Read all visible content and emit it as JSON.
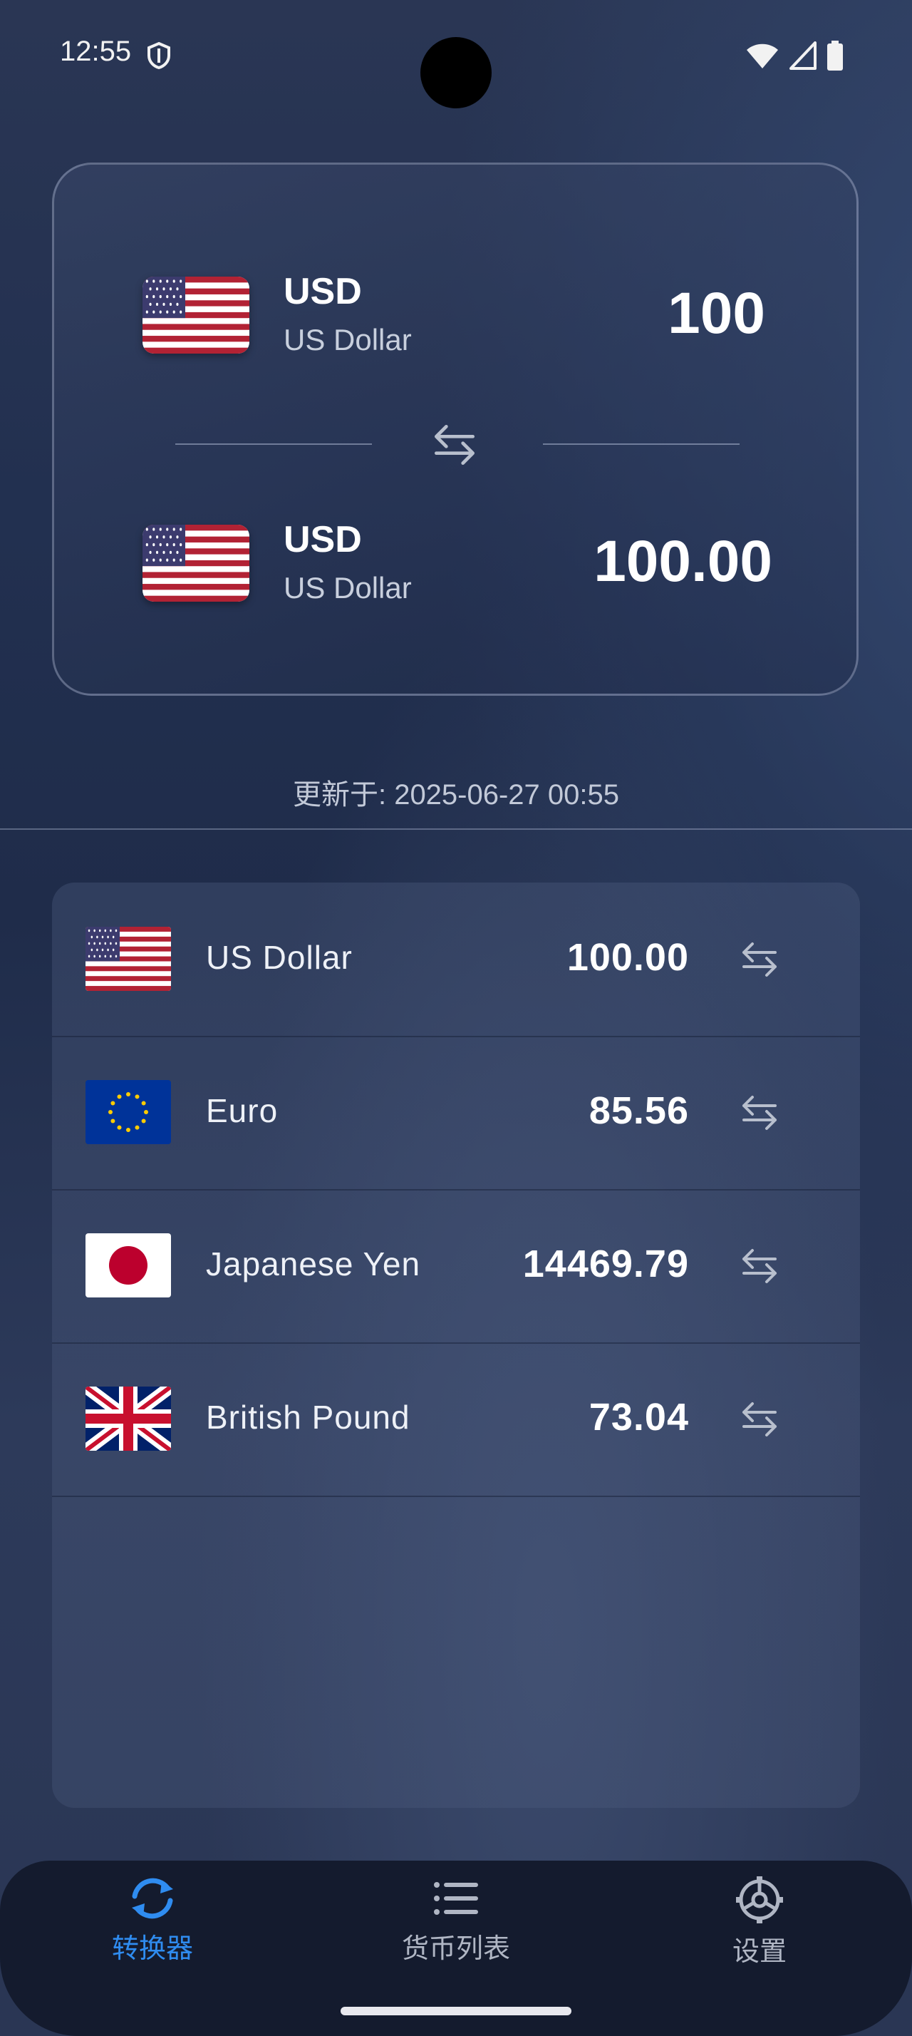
{
  "status_bar": {
    "time": "12:55"
  },
  "converter": {
    "from": {
      "code": "USD",
      "name": "US Dollar",
      "amount": "100",
      "flag": "us-flag"
    },
    "to": {
      "code": "USD",
      "name": "US Dollar",
      "amount": "100.00",
      "flag": "us-flag"
    },
    "swap_icon": "swap-horizontal-icon"
  },
  "updated_text": "更新于: 2025-06-27 00:55",
  "rates": [
    {
      "name": "US Dollar",
      "value": "100.00",
      "flag": "us-flag"
    },
    {
      "name": "Euro",
      "value": "85.56",
      "flag": "eu-flag"
    },
    {
      "name": "Japanese Yen",
      "value": "14469.79",
      "flag": "jp-flag"
    },
    {
      "name": "British Pound",
      "value": "73.04",
      "flag": "gb-flag"
    }
  ],
  "nav": {
    "items": [
      {
        "label": "转换器",
        "icon": "refresh-icon",
        "active": true
      },
      {
        "label": "货币列表",
        "icon": "list-icon",
        "active": false
      },
      {
        "label": "设置",
        "icon": "gear-icon",
        "active": false
      }
    ]
  },
  "colors": {
    "accent": "#2f8cf0",
    "inactive": "#b0b6c4",
    "nav_bg": "#141b2e"
  }
}
